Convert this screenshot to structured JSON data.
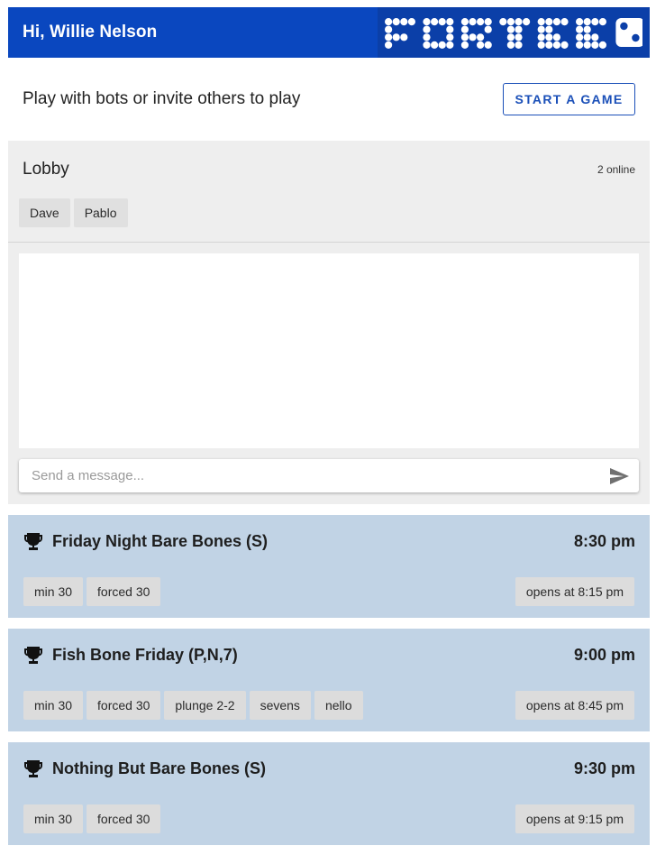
{
  "header": {
    "greeting": "Hi, Willie Nelson",
    "logo_text": "FORTEE"
  },
  "topbar": {
    "tagline": "Play with bots or invite others to play",
    "start_button": "START A GAME"
  },
  "lobby": {
    "title": "Lobby",
    "online_count": "2 online",
    "users": [
      "Dave",
      "Pablo"
    ],
    "message_placeholder": "Send a message..."
  },
  "events": [
    {
      "name": "Friday Night Bare Bones (S)",
      "time": "8:30 pm",
      "tags": [
        "min 30",
        "forced 30"
      ],
      "opens": "opens at 8:15 pm"
    },
    {
      "name": "Fish Bone Friday (P,N,7)",
      "time": "9:00 pm",
      "tags": [
        "min 30",
        "forced 30",
        "plunge 2-2",
        "sevens",
        "nello"
      ],
      "opens": "opens at 8:45 pm"
    },
    {
      "name": "Nothing But Bare Bones (S)",
      "time": "9:30 pm",
      "tags": [
        "min 30",
        "forced 30"
      ],
      "opens": "opens at 9:15 pm"
    }
  ],
  "colors": {
    "header_bg": "#0a47bf",
    "accent": "#1a4fb8",
    "lobby_bg": "#eeeeee",
    "event_bg": "#c1d3e5"
  },
  "icons": {
    "trophy": "trophy-icon",
    "send": "send-icon",
    "logo_die": "die-icon"
  }
}
